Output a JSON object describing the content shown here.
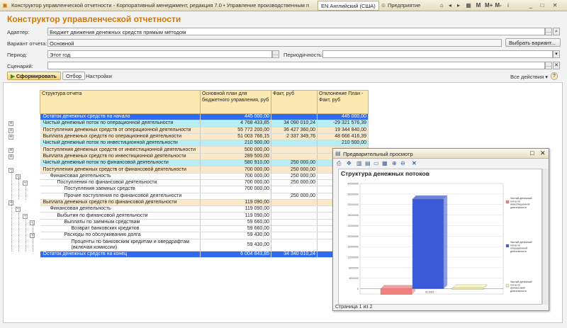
{
  "window": {
    "title": "Конструктор управленческой отчетности - Корпоративный менеджмент, редакция 7.0 • Управление производственным п",
    "lang": "EN Английский (США)",
    "mode": "Предприятие"
  },
  "form": {
    "title": "Конструктор управленческой отчетности",
    "adapter_label": "Адаптер:",
    "adapter_value": "Бюджет движения денежных средств прямым методом",
    "variant_label": "Вариант отчета:",
    "variant_value": "Основной",
    "choose_variant": "Выбрать вариант...",
    "period_label": "Период:",
    "period_value": "Этот год",
    "periodicity_label": "Периодичность:",
    "periodicity_value": "",
    "scenario_label": "Сценарий:",
    "scenario_value": ""
  },
  "toolbar": {
    "generate": "Сформировать",
    "selection": "Отбор",
    "settings": "Настройки",
    "all_actions": "Все действия",
    "help": "?"
  },
  "table": {
    "headers": [
      "Структура отчета",
      "Основной план для бюджетного управления, руб",
      "Факт, руб",
      "Отклонение План - Факт, руб"
    ],
    "rows": [
      {
        "style": "blue",
        "indent": 0,
        "name": "Остаток денежных средств на начало",
        "plan": "445 000,00",
        "fact": "",
        "dev": "445 000,00"
      },
      {
        "style": "cyan",
        "indent": 0,
        "name": "Чистый денежный поток по операционной деятельности",
        "plan": "4 768 433,85",
        "fact": "34 090 010,24",
        "dev": "-29 321 576,39"
      },
      {
        "style": "peach",
        "indent": 0,
        "name": "Поступления денежных средств от операционной деятельности",
        "plan": "55 772 200,00",
        "fact": "36 427 360,00",
        "dev": "19 344 840,00"
      },
      {
        "style": "peach",
        "indent": 0,
        "name": "Выплата денежных средств по операционной деятельности",
        "plan": "51 003 766,15",
        "fact": "2 337 349,76",
        "dev": "48 666 416,39"
      },
      {
        "style": "cyan",
        "indent": 0,
        "name": "Чистый денежный поток по инвестиционной деятельности",
        "plan": "210 500,00",
        "fact": "",
        "dev": "210 500,00"
      },
      {
        "style": "peach",
        "indent": 0,
        "name": "Поступления денежных средств от инвестиционной деятельности",
        "plan": "500 000,00",
        "fact": "",
        "dev": ""
      },
      {
        "style": "peach",
        "indent": 0,
        "name": "Выплата денежных средств по инвестиционной деятельности",
        "plan": "289 500,00",
        "fact": "",
        "dev": ""
      },
      {
        "style": "cyan",
        "indent": 0,
        "name": "Чистый денежный поток по финансовой деятельности",
        "plan": "580 910,00",
        "fact": "250 000,00",
        "dev": ""
      },
      {
        "style": "peach",
        "indent": 0,
        "name": "Поступления денежных средств от финансовой деятельности",
        "plan": "700 000,00",
        "fact": "250 000,00",
        "dev": ""
      },
      {
        "style": "white",
        "indent": 1,
        "name": "Финансовая деятельность",
        "plan": "700 000,00",
        "fact": "250 000,00",
        "dev": ""
      },
      {
        "style": "white",
        "indent": 2,
        "name": "Поступления по финансовой деятельности",
        "plan": "700 000,00",
        "fact": "250 000,00",
        "dev": ""
      },
      {
        "style": "white",
        "indent": 3,
        "name": "Поступления заемных средств",
        "plan": "700 000,00",
        "fact": "",
        "dev": ""
      },
      {
        "style": "white",
        "indent": 3,
        "name": "Прочие поступления по финансовой деятельности",
        "plan": "",
        "fact": "250 000,00",
        "dev": ""
      },
      {
        "style": "peach",
        "indent": 0,
        "name": "Выплата денежных средств по финансовой деятельности",
        "plan": "119 090,00",
        "fact": "",
        "dev": ""
      },
      {
        "style": "white",
        "indent": 1,
        "name": "Финансовая деятельность",
        "plan": "119 090,00",
        "fact": "",
        "dev": ""
      },
      {
        "style": "white",
        "indent": 2,
        "name": "Выбытия по финансовой деятельности",
        "plan": "119 090,00",
        "fact": "",
        "dev": ""
      },
      {
        "style": "white",
        "indent": 3,
        "name": "Выплаты по заемным средствам",
        "plan": "59 660,00",
        "fact": "",
        "dev": ""
      },
      {
        "style": "white",
        "indent": 4,
        "name": "Возврат банковских кредитов",
        "plan": "59 660,00",
        "fact": "",
        "dev": ""
      },
      {
        "style": "white",
        "indent": 3,
        "name": "Расходы по обслуживанию долга",
        "plan": "59 430,00",
        "fact": "",
        "dev": ""
      },
      {
        "style": "white",
        "indent": 4,
        "name": "Проценты по банковским кредитам и овердрафтам",
        "name2": "(включая комиссии)",
        "plan": "59 430,00",
        "fact": "",
        "dev": ""
      },
      {
        "style": "blue",
        "indent": 0,
        "name": "Остаток денежных средств на конец",
        "plan": "6 004 843,85",
        "fact": "34 340 010,24",
        "dev": ""
      }
    ]
  },
  "preview": {
    "title": "Предварительный просмотр",
    "status": "Страница 1 из 2"
  },
  "chart_data": {
    "type": "bar",
    "title": "Структура денежных потоков",
    "categories": [
      "01.2011"
    ],
    "series": [
      {
        "name": "Чистый денежный поток по инвестиционной деятельности",
        "values": [
          -2200000
        ],
        "color": "#f08080"
      },
      {
        "name": "Чистый денежный поток по операционной деятельности",
        "values": [
          34090010.24
        ],
        "color": "#3b5bdb"
      },
      {
        "name": "Чистый денежный поток по финансовой деятельности",
        "values": [
          250000
        ],
        "color": "#f5f0a6"
      }
    ],
    "ylim": [
      -2000000,
      40000000
    ]
  }
}
